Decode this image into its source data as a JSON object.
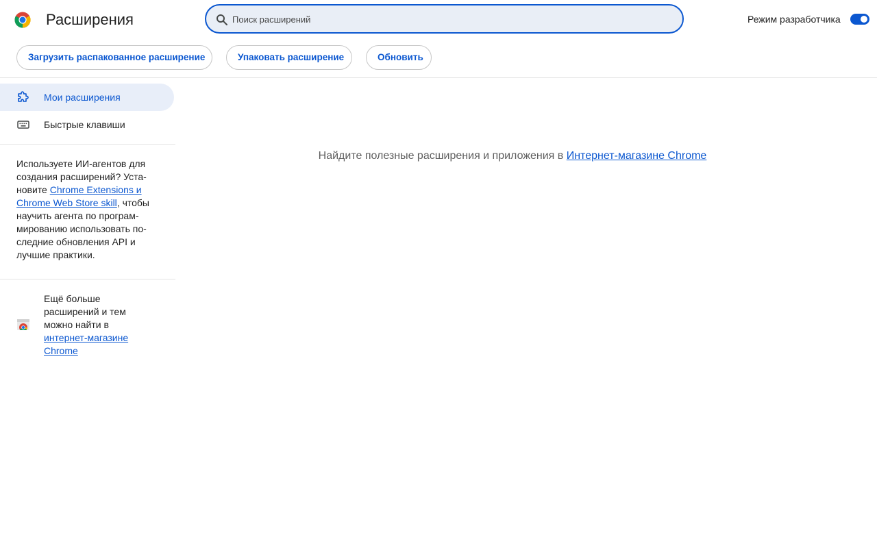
{
  "header": {
    "title": "Расширения",
    "search_placeholder": "Поиск расширений",
    "dev_mode_label": "Режим разработчика",
    "dev_mode_enabled": true
  },
  "toolbar": {
    "load_unpacked": "Загрузить распакованное расширение",
    "pack": "Упаковать расширение",
    "update": "Обновить"
  },
  "sidebar": {
    "items": [
      {
        "label": "Мои расширения",
        "icon": "puzzle-icon",
        "active": true
      },
      {
        "label": "Быстрые клавиши",
        "icon": "keyboard-icon",
        "active": false
      }
    ],
    "ai_notice": {
      "before": "Используете ИИ-агентов для создания расширений? Уста­новите ",
      "link": "Chrome Extensions и Chrome Web Store skill",
      "after": ", чтобы научить агента по програм­мированию использовать по­следние обновления API и лучшие практики."
    },
    "store_promo": {
      "before": "Ещё больше расширений и тем можно найти в ",
      "link": "интернет-магазине Chrome"
    }
  },
  "main": {
    "message_before": "Найдите полезные расширения и приложения в ",
    "message_link": "Интернет-магазине Chrome"
  },
  "colors": {
    "accent": "#0b57d0",
    "active_bg": "#e8eef9",
    "search_bg": "#e9eef6"
  }
}
